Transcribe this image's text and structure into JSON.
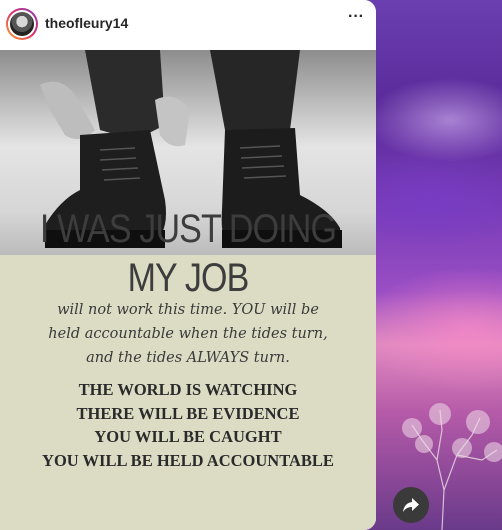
{
  "post": {
    "username": "theofleury14",
    "more_label": "···"
  },
  "meme": {
    "headline_line1": "I WAS JUST DOING",
    "headline_line2": "MY JOB",
    "body_lines": [
      "will not work this time. YOU will be",
      "held accountable when the tides turn,",
      "and the tides ALWAYS turn."
    ],
    "caps_lines": [
      "THE WORLD IS WATCHING",
      "THERE WILL BE EVIDENCE",
      "YOU WILL BE CAUGHT",
      "YOU WILL BE HELD ACCOUNTABLE"
    ]
  },
  "icons": {
    "share": "share-arrow-icon",
    "more": "more-options-icon"
  },
  "colors": {
    "meme_background": "#dcdcc4",
    "headline_text": "#3d3d3d",
    "share_button_bg": "#3a3a3a",
    "sky_purple": "#6b3fb0",
    "sky_pink": "#e08ac0"
  }
}
